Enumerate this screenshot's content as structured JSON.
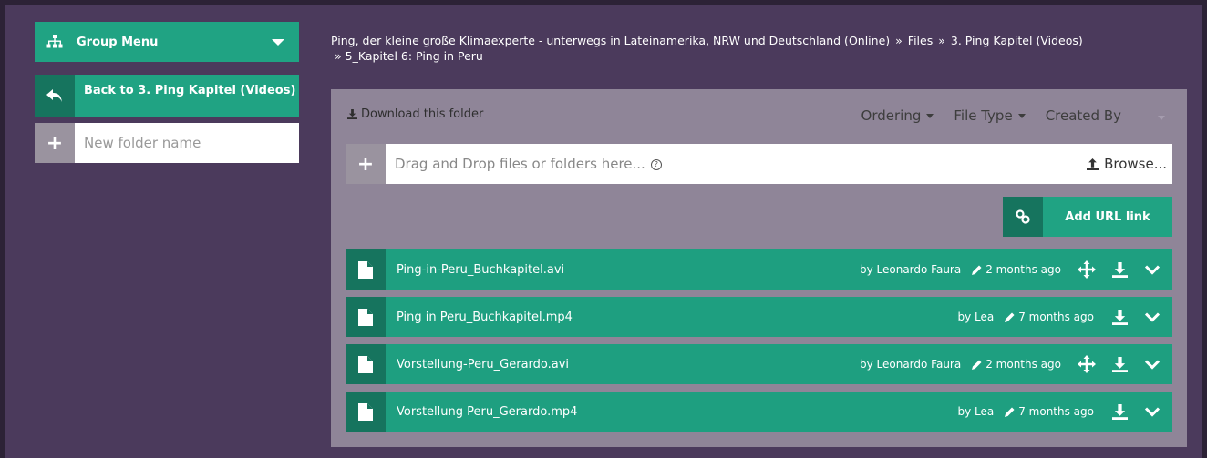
{
  "sidebar": {
    "group_menu": "Group Menu",
    "back_label": "Back to 3. Ping Kapitel (Videos)",
    "new_folder_placeholder": "New folder name"
  },
  "breadcrumb": {
    "items": [
      "Ping, der kleine große Klimaexperte - unterwegs in Lateinamerika, NRW und Deutschland (Online)",
      "Files",
      "3. Ping Kapitel (Videos)"
    ],
    "separator": "»",
    "current": "5_Kapitel 6: Ping in Peru"
  },
  "toolbar": {
    "download_folder": "Download this folder",
    "ordering": "Ordering",
    "file_type": "File Type",
    "created_by": "Created By"
  },
  "dropzone": {
    "text": "Drag and Drop files or folders here...",
    "browse": "Browse..."
  },
  "add_url": "Add URL link",
  "files": [
    {
      "name": "Ping-in-Peru_Buchkapitel.avi",
      "author": "by Leonardo Faura",
      "time": "2 months ago",
      "movable": true
    },
    {
      "name": "Ping in Peru_Buchkapitel.mp4",
      "author": "by Lea",
      "time": "7 months ago",
      "movable": false
    },
    {
      "name": "Vorstellung-Peru_Gerardo.avi",
      "author": "by Leonardo Faura",
      "time": "2 months ago",
      "movable": true
    },
    {
      "name": "Vorstellung Peru_Gerardo.mp4",
      "author": "by Lea",
      "time": "7 months ago",
      "movable": false
    }
  ],
  "colors": {
    "background": "#4b3a5c",
    "panel": "#8f8598",
    "accent": "#20a383",
    "accent_dark": "#16745e"
  }
}
